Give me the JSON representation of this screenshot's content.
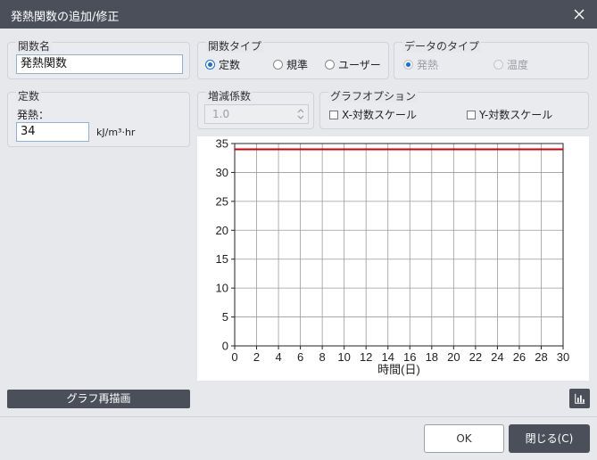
{
  "window": {
    "title": "発熱関数の追加/修正"
  },
  "function_name": {
    "label": "関数名",
    "value": "発熱関数"
  },
  "function_type": {
    "label": "関数タイプ",
    "options": [
      {
        "label": "定数",
        "selected": true
      },
      {
        "label": "規準",
        "selected": false
      },
      {
        "label": "ユーザー",
        "selected": false
      }
    ]
  },
  "data_type": {
    "label": "データのタイプ",
    "options": [
      {
        "label": "発熱",
        "selected": true
      },
      {
        "label": "温度",
        "selected": false
      }
    ]
  },
  "constant": {
    "label": "定数",
    "field_label": "発熱：",
    "value": "34",
    "unit": "kJ/m³·hr"
  },
  "increment": {
    "label": "増減係数",
    "value": "1.0"
  },
  "graph_options": {
    "label": "グラフオプション",
    "x_log_label": "X-対数スケール",
    "x_log": false,
    "y_log_label": "Y-対数スケール",
    "y_log": false
  },
  "chart_data": {
    "type": "line",
    "xlabel": "時間(日)",
    "ylabel": "",
    "xlim": [
      0,
      30
    ],
    "ylim": [
      0,
      35
    ],
    "x_ticks": [
      "0",
      "2",
      "4",
      "6",
      "8",
      "10",
      "12",
      "14",
      "16",
      "18",
      "20",
      "22",
      "24",
      "26",
      "28",
      "30"
    ],
    "y_ticks": [
      "0",
      "5",
      "10",
      "15",
      "20",
      "25",
      "30",
      "35"
    ],
    "grid": true,
    "series": [
      {
        "x": [
          0,
          30
        ],
        "y": [
          34,
          34
        ],
        "color": "#cc0000"
      }
    ]
  },
  "buttons": {
    "redraw": "グラフ再描画",
    "ok": "OK",
    "close": "閉じる(C)"
  },
  "icons": {
    "close": "close-icon",
    "chart": "bar-chart-icon"
  }
}
